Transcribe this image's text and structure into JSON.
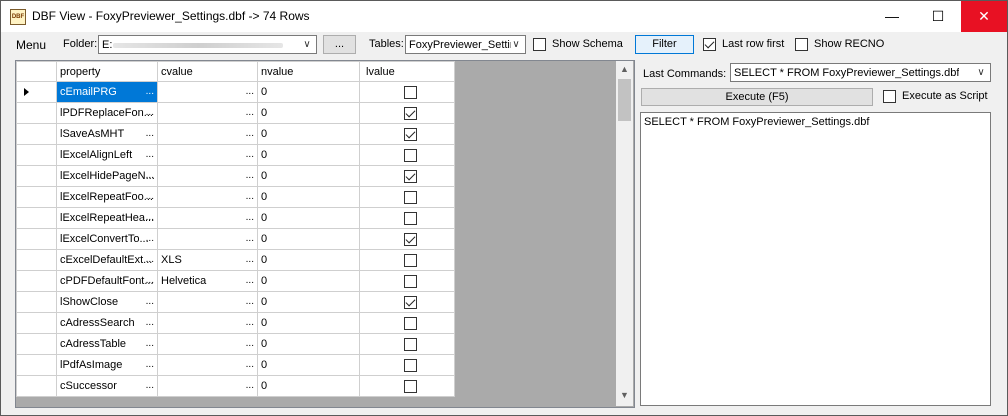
{
  "window": {
    "title": "DBF View - FoxyPreviewer_Settings.dbf -> 74 Rows",
    "app_icon_text": "DBF",
    "minimize_glyph": "—",
    "maximize_glyph": "☐",
    "close_glyph": "✕"
  },
  "toolbar": {
    "menu_label": "Menu",
    "folder_label": "Folder:",
    "folder_value": "E:",
    "browse_label": "...",
    "tables_label": "Tables:",
    "tables_value": "FoxyPreviewer_Settir",
    "show_schema_label": "Show Schema",
    "show_schema_checked": false,
    "filter_label": "Filter",
    "last_row_first_label": "Last row first",
    "last_row_first_checked": true,
    "show_recno_label": "Show RECNO",
    "show_recno_checked": false
  },
  "grid": {
    "columns": [
      "property",
      "cvalue",
      "nvalue",
      "lvalue"
    ],
    "rows": [
      {
        "property": "cEmailPRG",
        "cvalue": "",
        "nvalue": "0",
        "lvalue": false,
        "selected": true
      },
      {
        "property": "lPDFReplaceFon...",
        "cvalue": "",
        "nvalue": "0",
        "lvalue": true
      },
      {
        "property": "lSaveAsMHT",
        "cvalue": "",
        "nvalue": "0",
        "lvalue": true
      },
      {
        "property": "lExcelAlignLeft",
        "cvalue": "",
        "nvalue": "0",
        "lvalue": false
      },
      {
        "property": "lExcelHidePageN...",
        "cvalue": "",
        "nvalue": "0",
        "lvalue": true
      },
      {
        "property": "lExcelRepeatFoo...",
        "cvalue": "",
        "nvalue": "0",
        "lvalue": false
      },
      {
        "property": "lExcelRepeatHea...",
        "cvalue": "",
        "nvalue": "0",
        "lvalue": false
      },
      {
        "property": "lExcelConvertTo...",
        "cvalue": "",
        "nvalue": "0",
        "lvalue": true
      },
      {
        "property": "cExcelDefaultExt...",
        "cvalue": "XLS",
        "nvalue": "0",
        "lvalue": false
      },
      {
        "property": "cPDFDefaultFont...",
        "cvalue": "Helvetica",
        "nvalue": "0",
        "lvalue": false
      },
      {
        "property": "lShowClose",
        "cvalue": "",
        "nvalue": "0",
        "lvalue": true
      },
      {
        "property": "cAdressSearch",
        "cvalue": "",
        "nvalue": "0",
        "lvalue": false
      },
      {
        "property": "cAdressTable",
        "cvalue": "",
        "nvalue": "0",
        "lvalue": false
      },
      {
        "property": "lPdfAsImage",
        "cvalue": "",
        "nvalue": "0",
        "lvalue": false
      },
      {
        "property": "cSuccessor",
        "cvalue": "",
        "nvalue": "0",
        "lvalue": false
      }
    ],
    "ellipsis": "..."
  },
  "commands": {
    "last_commands_label": "Last Commands:",
    "last_commands_value": "SELECT * FROM FoxyPreviewer_Settings.dbf",
    "execute_label": "Execute (F5)",
    "execute_as_script_label": "Execute as Script",
    "execute_as_script_checked": false,
    "sql_text": "SELECT * FROM FoxyPreviewer_Settings.dbf"
  }
}
